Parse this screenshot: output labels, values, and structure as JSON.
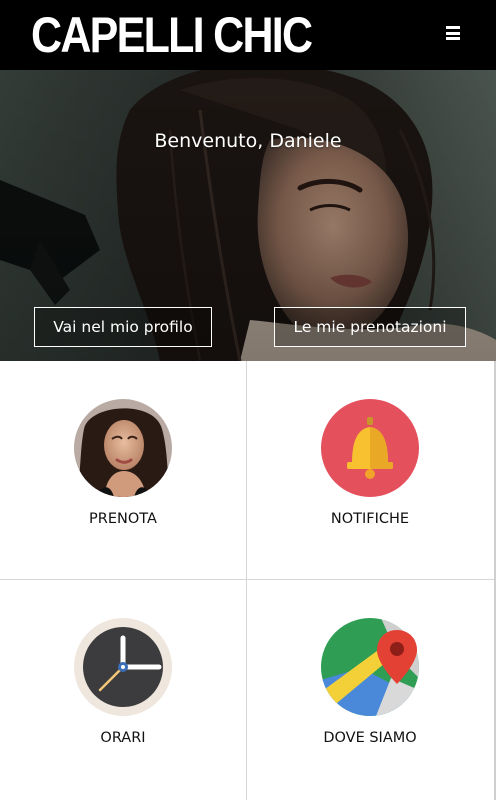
{
  "header": {
    "logo_text": "CAPELLI CHIC",
    "menu_icon": "hamburger-icon"
  },
  "hero": {
    "greeting": "Benvenuto, Daniele",
    "profile_button": "Vai nel mio profilo",
    "bookings_button": "Le mie prenotazioni"
  },
  "tiles": [
    {
      "label": "PRENOTA",
      "icon": "woman-portrait-icon"
    },
    {
      "label": "NOTIFICHE",
      "icon": "bell-icon",
      "color": "#e4505c"
    },
    {
      "label": "ORARI",
      "icon": "clock-icon"
    },
    {
      "label": "DOVE SIAMO",
      "icon": "map-icon"
    }
  ],
  "colors": {
    "header_bg": "#000000",
    "bell_circle": "#e4505c",
    "bell": "#f7c12f"
  }
}
